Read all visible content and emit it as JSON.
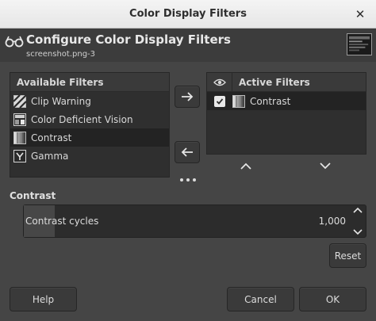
{
  "window": {
    "title": "Color Display Filters"
  },
  "header": {
    "title": "Configure Color Display Filters",
    "subtitle": "screenshot.png-3"
  },
  "available": {
    "heading": "Available Filters",
    "items": [
      {
        "label": "Clip Warning",
        "icon": "clip-warning-icon"
      },
      {
        "label": "Color Deficient Vision",
        "icon": "color-deficient-icon"
      },
      {
        "label": "Contrast",
        "icon": "contrast-icon",
        "selected": true
      },
      {
        "label": "Gamma",
        "icon": "gamma-icon"
      }
    ]
  },
  "active": {
    "heading": "Active Filters",
    "items": [
      {
        "label": "Contrast",
        "icon": "contrast-icon",
        "enabled": true
      }
    ]
  },
  "settings": {
    "section_title": "Contrast",
    "param_label": "Contrast cycles",
    "param_value": "1,000",
    "param_level": 0.09
  },
  "buttons": {
    "reset": "Reset",
    "help": "Help",
    "cancel": "Cancel",
    "ok": "OK"
  },
  "colors": {
    "window_bg": "#454545",
    "panel_bg": "#2f2f2f",
    "selected_row": "#232323"
  }
}
